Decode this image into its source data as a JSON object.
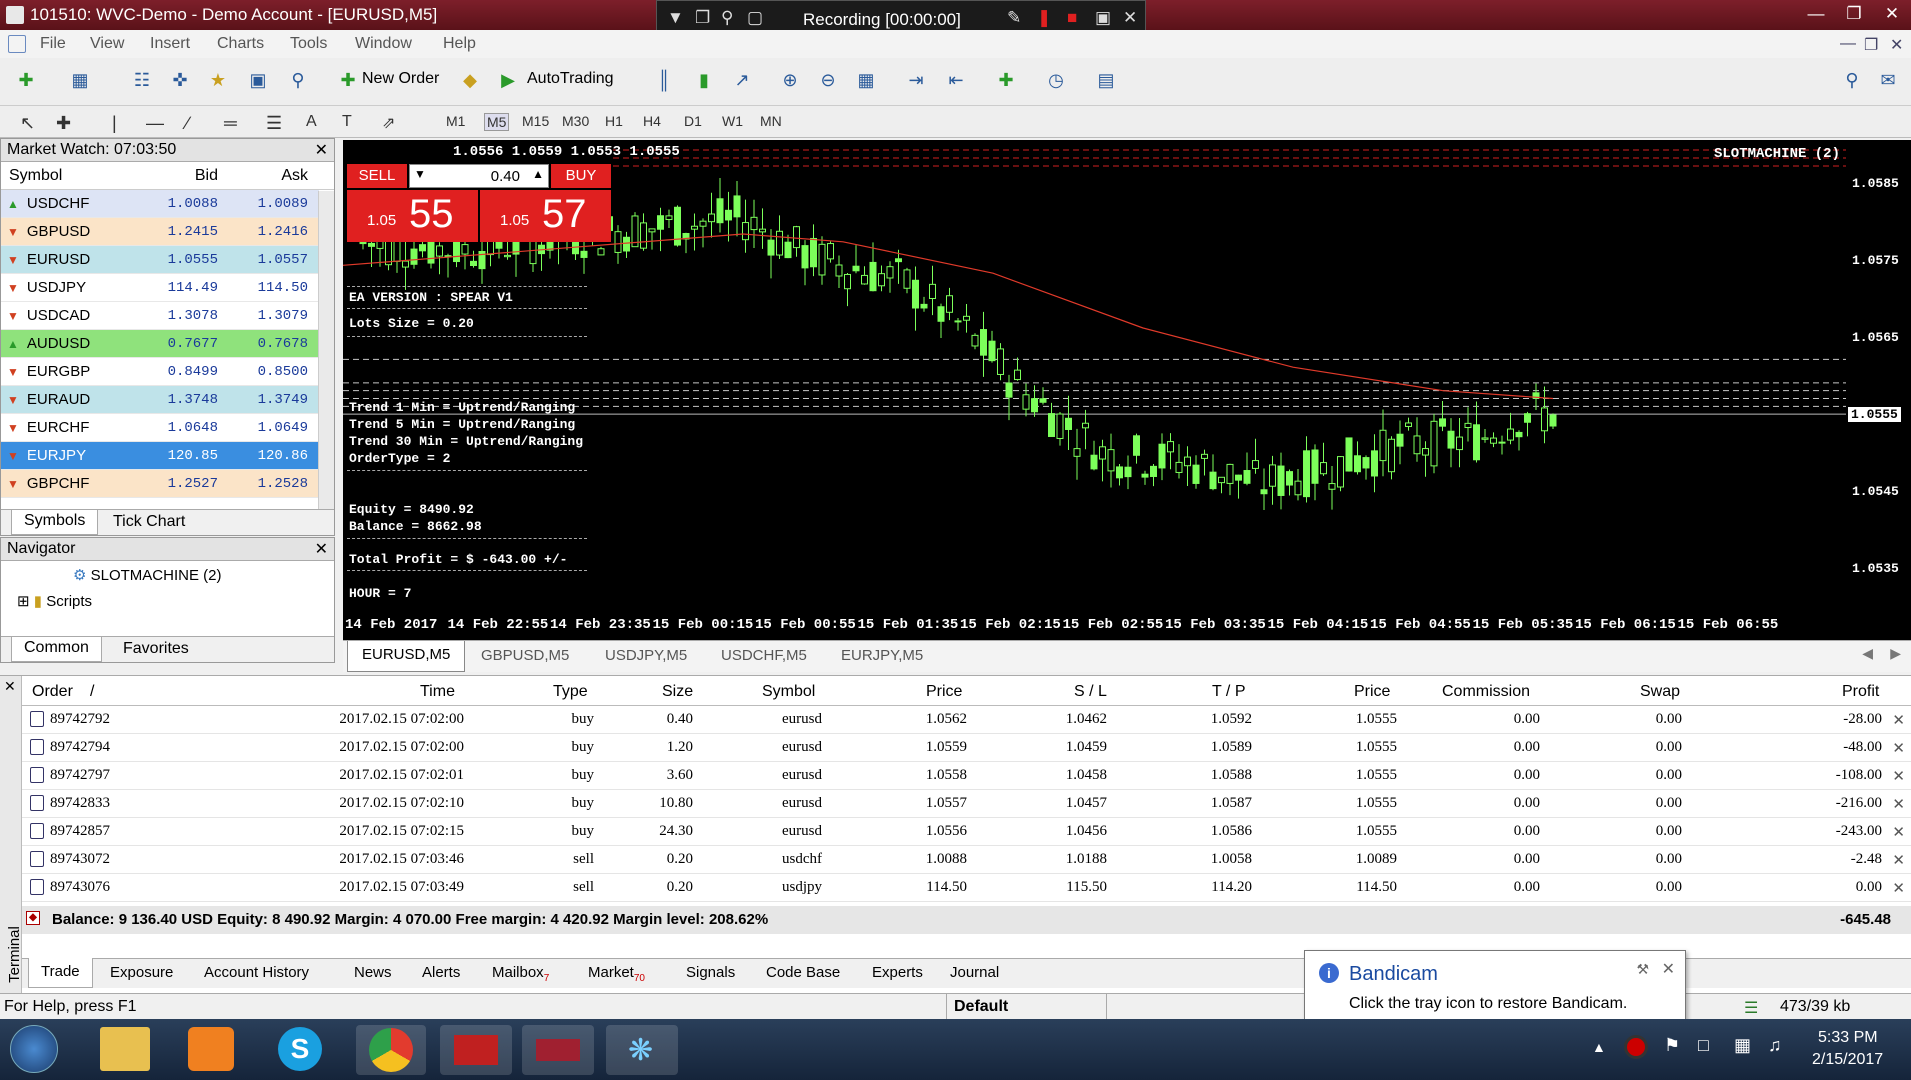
{
  "window": {
    "title": "101510: WVC-Demo - Demo Account - [EURUSD,M5]"
  },
  "recorder": {
    "status": "Recording [00:00:00]"
  },
  "menu": [
    "File",
    "View",
    "Insert",
    "Charts",
    "Tools",
    "Window",
    "Help"
  ],
  "toolbar": {
    "new_order": "New Order",
    "autotrading": "AutoTrading",
    "timeframes": [
      "M1",
      "M5",
      "M15",
      "M30",
      "H1",
      "H4",
      "D1",
      "W1",
      "MN"
    ]
  },
  "market_watch": {
    "title": "Market Watch: 07:03:50",
    "columns": [
      "Symbol",
      "Bid",
      "Ask"
    ],
    "rows": [
      {
        "symbol": "USDCHF",
        "bid": "1.0088",
        "ask": "1.0089",
        "dir": "up",
        "bg": "#dde4f5"
      },
      {
        "symbol": "GBPUSD",
        "bid": "1.2415",
        "ask": "1.2416",
        "dir": "down",
        "bg": "#fbe4c8"
      },
      {
        "symbol": "EURUSD",
        "bid": "1.0555",
        "ask": "1.0557",
        "dir": "down",
        "bg": "#bfe3ea"
      },
      {
        "symbol": "USDJPY",
        "bid": "114.49",
        "ask": "114.50",
        "dir": "down",
        "bg": "#ffffff"
      },
      {
        "symbol": "USDCAD",
        "bid": "1.3078",
        "ask": "1.3079",
        "dir": "down",
        "bg": "#ffffff"
      },
      {
        "symbol": "AUDUSD",
        "bid": "0.7677",
        "ask": "0.7678",
        "dir": "up",
        "bg": "#8fe27c"
      },
      {
        "symbol": "EURGBP",
        "bid": "0.8499",
        "ask": "0.8500",
        "dir": "down",
        "bg": "#ffffff"
      },
      {
        "symbol": "EURAUD",
        "bid": "1.3748",
        "ask": "1.3749",
        "dir": "down",
        "bg": "#bfe3ea"
      },
      {
        "symbol": "EURCHF",
        "bid": "1.0648",
        "ask": "1.0649",
        "dir": "down",
        "bg": "#ffffff"
      },
      {
        "symbol": "EURJPY",
        "bid": "120.85",
        "ask": "120.86",
        "dir": "down",
        "bg": "#3a8ee0"
      },
      {
        "symbol": "GBPCHF",
        "bid": "1.2527",
        "ask": "1.2528",
        "dir": "down",
        "bg": "#fbe4c8"
      }
    ],
    "tabs": [
      "Symbols",
      "Tick Chart"
    ]
  },
  "navigator": {
    "title": "Navigator",
    "items": [
      "SLOTMACHINE (2)",
      "Scripts"
    ],
    "tabs": [
      "Common",
      "Favorites"
    ]
  },
  "chart": {
    "ohlc": "1.0556 1.0559 1.0553 1.0555",
    "ea_name": "SLOTMACHINE (2)",
    "sell_label": "SELL",
    "buy_label": "BUY",
    "lot": "0.40",
    "sell_price_small": "1.05",
    "sell_price_big": "55",
    "buy_price_small": "1.05",
    "buy_price_big": "57",
    "price_ticks": [
      "1.0585",
      "1.0575",
      "1.0565",
      "1.0555",
      "1.0545",
      "1.0535"
    ],
    "current_price": "1.0555",
    "time_ticks": [
      "14 Feb 2017",
      "14 Feb 22:55",
      "14 Feb 23:35",
      "15 Feb 00:15",
      "15 Feb 00:55",
      "15 Feb 01:35",
      "15 Feb 02:15",
      "15 Feb 02:55",
      "15 Feb 03:35",
      "15 Feb 04:15",
      "15 Feb 04:55",
      "15 Feb 05:35",
      "15 Feb 06:15",
      "15 Feb 06:55"
    ],
    "ea_info": [
      "EA VERSION   : SPEAR V1",
      "Lots Size       = 0.20",
      "Trend  1 Min     = Uptrend/Ranging",
      "Trend  5 Min     = Uptrend/Ranging",
      "Trend 30 Min     = Uptrend/Ranging",
      "OrderType       = 2",
      "Equity          = 8490.92",
      "Balance         = 8662.98",
      "Total Profit     = $ -643.00 +/-",
      "HOUR         = 7"
    ],
    "tabs": [
      "EURUSD,M5",
      "GBPUSD,M5",
      "USDJPY,M5",
      "USDCHF,M5",
      "EURJPY,M5"
    ]
  },
  "terminal": {
    "columns": [
      "Order",
      "/",
      "Time",
      "Type",
      "Size",
      "Symbol",
      "Price",
      "S / L",
      "T / P",
      "Price",
      "Commission",
      "Swap",
      "Profit"
    ],
    "rows": [
      {
        "order": "89742792",
        "time": "2017.02.15 07:02:00",
        "type": "buy",
        "size": "0.40",
        "symbol": "eurusd",
        "price": "1.0562",
        "sl": "1.0462",
        "tp": "1.0592",
        "cur": "1.0555",
        "comm": "0.00",
        "swap": "0.00",
        "profit": "-28.00"
      },
      {
        "order": "89742794",
        "time": "2017.02.15 07:02:00",
        "type": "buy",
        "size": "1.20",
        "symbol": "eurusd",
        "price": "1.0559",
        "sl": "1.0459",
        "tp": "1.0589",
        "cur": "1.0555",
        "comm": "0.00",
        "swap": "0.00",
        "profit": "-48.00"
      },
      {
        "order": "89742797",
        "time": "2017.02.15 07:02:01",
        "type": "buy",
        "size": "3.60",
        "symbol": "eurusd",
        "price": "1.0558",
        "sl": "1.0458",
        "tp": "1.0588",
        "cur": "1.0555",
        "comm": "0.00",
        "swap": "0.00",
        "profit": "-108.00"
      },
      {
        "order": "89742833",
        "time": "2017.02.15 07:02:10",
        "type": "buy",
        "size": "10.80",
        "symbol": "eurusd",
        "price": "1.0557",
        "sl": "1.0457",
        "tp": "1.0587",
        "cur": "1.0555",
        "comm": "0.00",
        "swap": "0.00",
        "profit": "-216.00"
      },
      {
        "order": "89742857",
        "time": "2017.02.15 07:02:15",
        "type": "buy",
        "size": "24.30",
        "symbol": "eurusd",
        "price": "1.0556",
        "sl": "1.0456",
        "tp": "1.0586",
        "cur": "1.0555",
        "comm": "0.00",
        "swap": "0.00",
        "profit": "-243.00"
      },
      {
        "order": "89743072",
        "time": "2017.02.15 07:03:46",
        "type": "sell",
        "size": "0.20",
        "symbol": "usdchf",
        "price": "1.0088",
        "sl": "1.0188",
        "tp": "1.0058",
        "cur": "1.0089",
        "comm": "0.00",
        "swap": "0.00",
        "profit": "-2.48"
      },
      {
        "order": "89743076",
        "time": "2017.02.15 07:03:49",
        "type": "sell",
        "size": "0.20",
        "symbol": "usdjpy",
        "price": "114.50",
        "sl": "115.50",
        "tp": "114.20",
        "cur": "114.50",
        "comm": "0.00",
        "swap": "0.00",
        "profit": "0.00"
      }
    ],
    "summary": "Balance: 9 136.40 USD  Equity: 8 490.92  Margin: 4 070.00  Free margin: 4 420.92  Margin level: 208.62%",
    "summary_profit": "-645.48",
    "side_label": "Terminal",
    "tabs": [
      "Trade",
      "Exposure",
      "Account History",
      "News",
      "Alerts",
      "Mailbox",
      "Market",
      "Signals",
      "Code Base",
      "Experts",
      "Journal"
    ],
    "mailbox_badge": "7",
    "market_badge": "70"
  },
  "status": {
    "help": "For Help, press F1",
    "profile": "Default",
    "traffic": "473/39 kb"
  },
  "bandicam": {
    "title": "Bandicam",
    "message": "Click the tray icon to restore Bandicam."
  },
  "taskbar": {
    "time": "5:33 PM",
    "date": "2/15/2017"
  },
  "colors": {
    "bull_candle": "#7cff5a",
    "bear_candle": "#000000",
    "ma_line": "#e03a2a",
    "trade_line": "#c8c8c8",
    "sell_btn": "#e02020"
  }
}
